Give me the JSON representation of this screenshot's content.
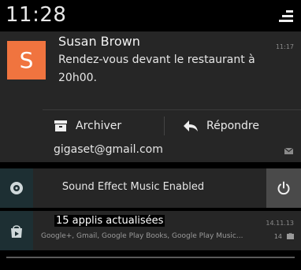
{
  "status_bar": {
    "time": "11:28",
    "quick_settings_icon": "quick-settings-icon"
  },
  "email_notification": {
    "avatar_letter": "S",
    "avatar_color": "#f0743f",
    "sender": "Susan Brown",
    "message": "Rendez-vous devant le restaurant à 20h00.",
    "time": "11:17",
    "actions": [
      {
        "label": "Archiver",
        "icon": "archive-icon"
      },
      {
        "label": "Répondre",
        "icon": "reply-icon"
      }
    ],
    "account": "gigaset@gmail.com",
    "account_icon": "mail-icon"
  },
  "sound_notification": {
    "icon": "sound-effect-icon",
    "text": "Sound Effect Music Enabled",
    "button_icon": "power-icon"
  },
  "apps_notification": {
    "icon": "apps-updated-icon",
    "title": "15 applis actualisées",
    "subtitle": "Google+, Gmail, Google Play Books, Google Play Music...",
    "time": "14.11.13",
    "count": "14",
    "small_icon": "play-store-icon"
  }
}
